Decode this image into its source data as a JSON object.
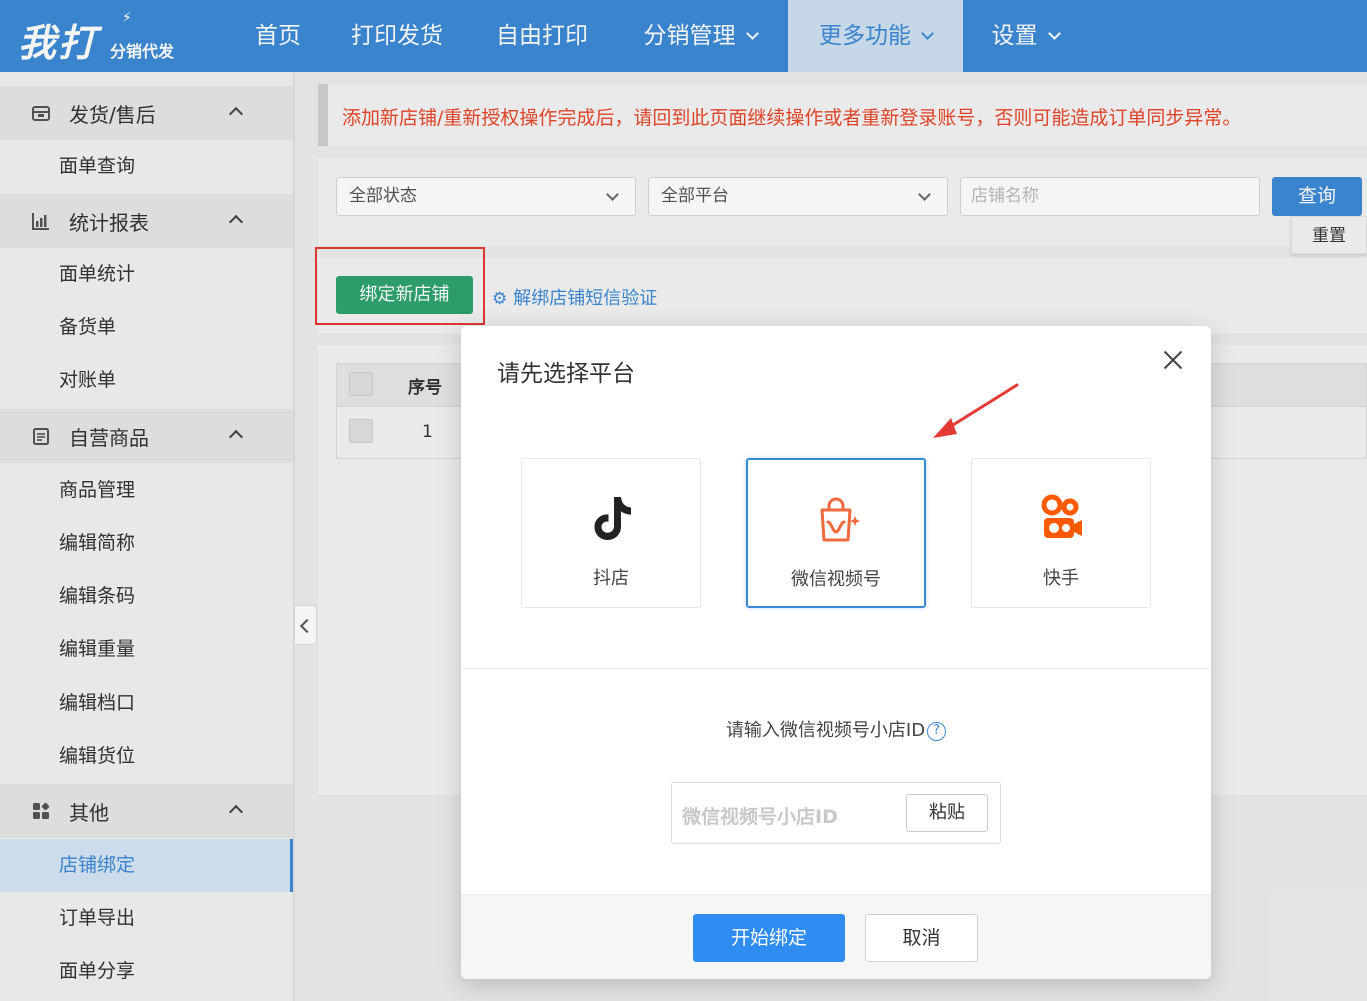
{
  "logo": {
    "main": "我打",
    "sub": "分销代发"
  },
  "nav": {
    "items": [
      {
        "label": "首页"
      },
      {
        "label": "打印发货"
      },
      {
        "label": "自由打印"
      },
      {
        "label": "分销管理"
      },
      {
        "label": "更多功能"
      },
      {
        "label": "设置"
      }
    ]
  },
  "sidebar": {
    "groups": [
      {
        "label": "发货/售后",
        "icon": "box-icon",
        "items": [
          "面单查询"
        ]
      },
      {
        "label": "统计报表",
        "icon": "chart-icon",
        "items": [
          "面单统计",
          "备货单",
          "对账单"
        ]
      },
      {
        "label": "自营商品",
        "icon": "clipboard-icon",
        "items": [
          "商品管理",
          "编辑简称",
          "编辑条码",
          "编辑重量",
          "编辑档口",
          "编辑货位"
        ]
      },
      {
        "label": "其他",
        "icon": "grid-icon",
        "items": [
          "店铺绑定",
          "订单导出",
          "面单分享"
        ]
      }
    ]
  },
  "notice": "添加新店铺/重新授权操作完成后，请回到此页面继续操作或者重新登录账号，否则可能造成订单同步异常。",
  "filters": {
    "status": "全部状态",
    "platform": "全部平台",
    "shop_placeholder": "店铺名称",
    "query": "查询",
    "reset": "重置"
  },
  "actions": {
    "bind_new": "绑定新店铺",
    "unbind_sms": "解绑店铺短信验证"
  },
  "table": {
    "header_seq": "序号",
    "rows": [
      {
        "seq": "1"
      }
    ]
  },
  "modal": {
    "title": "请先选择平台",
    "platforms": [
      {
        "label": "抖店",
        "icon": "tiktok-icon"
      },
      {
        "label": "微信视频号",
        "icon": "wechat-channels-icon"
      },
      {
        "label": "快手",
        "icon": "kuaishou-icon"
      }
    ],
    "id_label": "请输入微信视频号小店ID",
    "id_placeholder": "微信视频号小店ID",
    "paste": "粘贴",
    "start": "开始绑定",
    "cancel": "取消"
  },
  "colors": {
    "primary": "#3c8ad6",
    "bind_green": "#2ea36f",
    "notice_red": "#e8472a",
    "kuaishou_orange": "#ff5a00",
    "annotation_red": "#e53935"
  }
}
